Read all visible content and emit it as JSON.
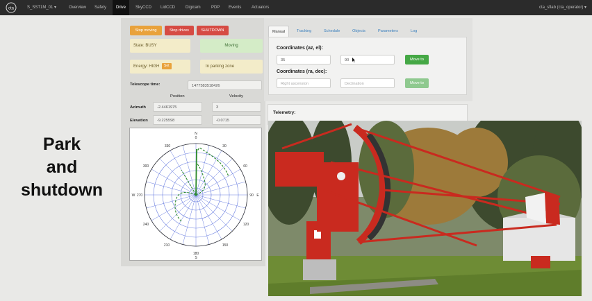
{
  "navbar": {
    "brand": "S_SST1M_01 ▾",
    "items": [
      {
        "label": "Overview",
        "active": false
      },
      {
        "label": "Safety",
        "active": false
      },
      {
        "label": "Drive",
        "active": true
      },
      {
        "label": "SkyCCD",
        "active": false
      },
      {
        "label": "LidCCD",
        "active": false
      },
      {
        "label": "Digicam",
        "active": false
      },
      {
        "label": "PDP",
        "active": false
      },
      {
        "label": "Events",
        "active": false
      },
      {
        "label": "Actuators",
        "active": false
      }
    ],
    "user": "cta_sflab (cta_operator) ▾"
  },
  "overlay_title": {
    "line1": "Park",
    "line2": "and",
    "line3": "shutdown"
  },
  "drive": {
    "buttons": {
      "stop_moving": "Stop moving",
      "stop_drives": "Stop drives",
      "shutdown": "SHUTDOWN"
    },
    "state": "State: BUSY",
    "moving": "Moving",
    "energy_label": "Energy: HIGH",
    "energy_badge": "Set",
    "parking": "In parking zone",
    "telescope_time_label": "Telescope time:",
    "telescope_time_value": "1477583518426",
    "position_header": "Position",
    "velocity_header": "Velocity",
    "azimuth_label": "Azimuth",
    "azimuth_position": "-2.4461975",
    "azimuth_velocity": "3",
    "elevation_label": "Elevation",
    "elevation_position": "-9.225598",
    "elevation_velocity": "-0.0715"
  },
  "polar": {
    "compass": {
      "n": "N",
      "s": "S",
      "e": "E",
      "w": "W"
    },
    "angles": {
      "a0": "0",
      "a30": "30",
      "a60": "60",
      "a90": "90",
      "a120": "120",
      "a150": "150",
      "a180": "180",
      "a210": "210",
      "a240": "240",
      "a270": "270",
      "a300": "300",
      "a330": "330"
    }
  },
  "tabs": [
    "Manual",
    "Tracking",
    "Schedule",
    "Objects",
    "Parameters",
    "Log"
  ],
  "manual": {
    "coord_azel_label": "Coordinates (az, el):",
    "az_value": "35",
    "el_value": "90",
    "move_to_1": "Move to",
    "coord_radec_label": "Coordinates (ra, dec):",
    "ra_placeholder": "Right ascension",
    "dec_placeholder": "Declination",
    "move_to_2": "Move to"
  },
  "telemetry": {
    "label": "Telemetry:"
  },
  "colors": {
    "navbar": "#2b2b2b",
    "orange": "#e9a23b",
    "red": "#d64b43",
    "green": "#45a845",
    "telescope_red": "#c92a1f"
  }
}
